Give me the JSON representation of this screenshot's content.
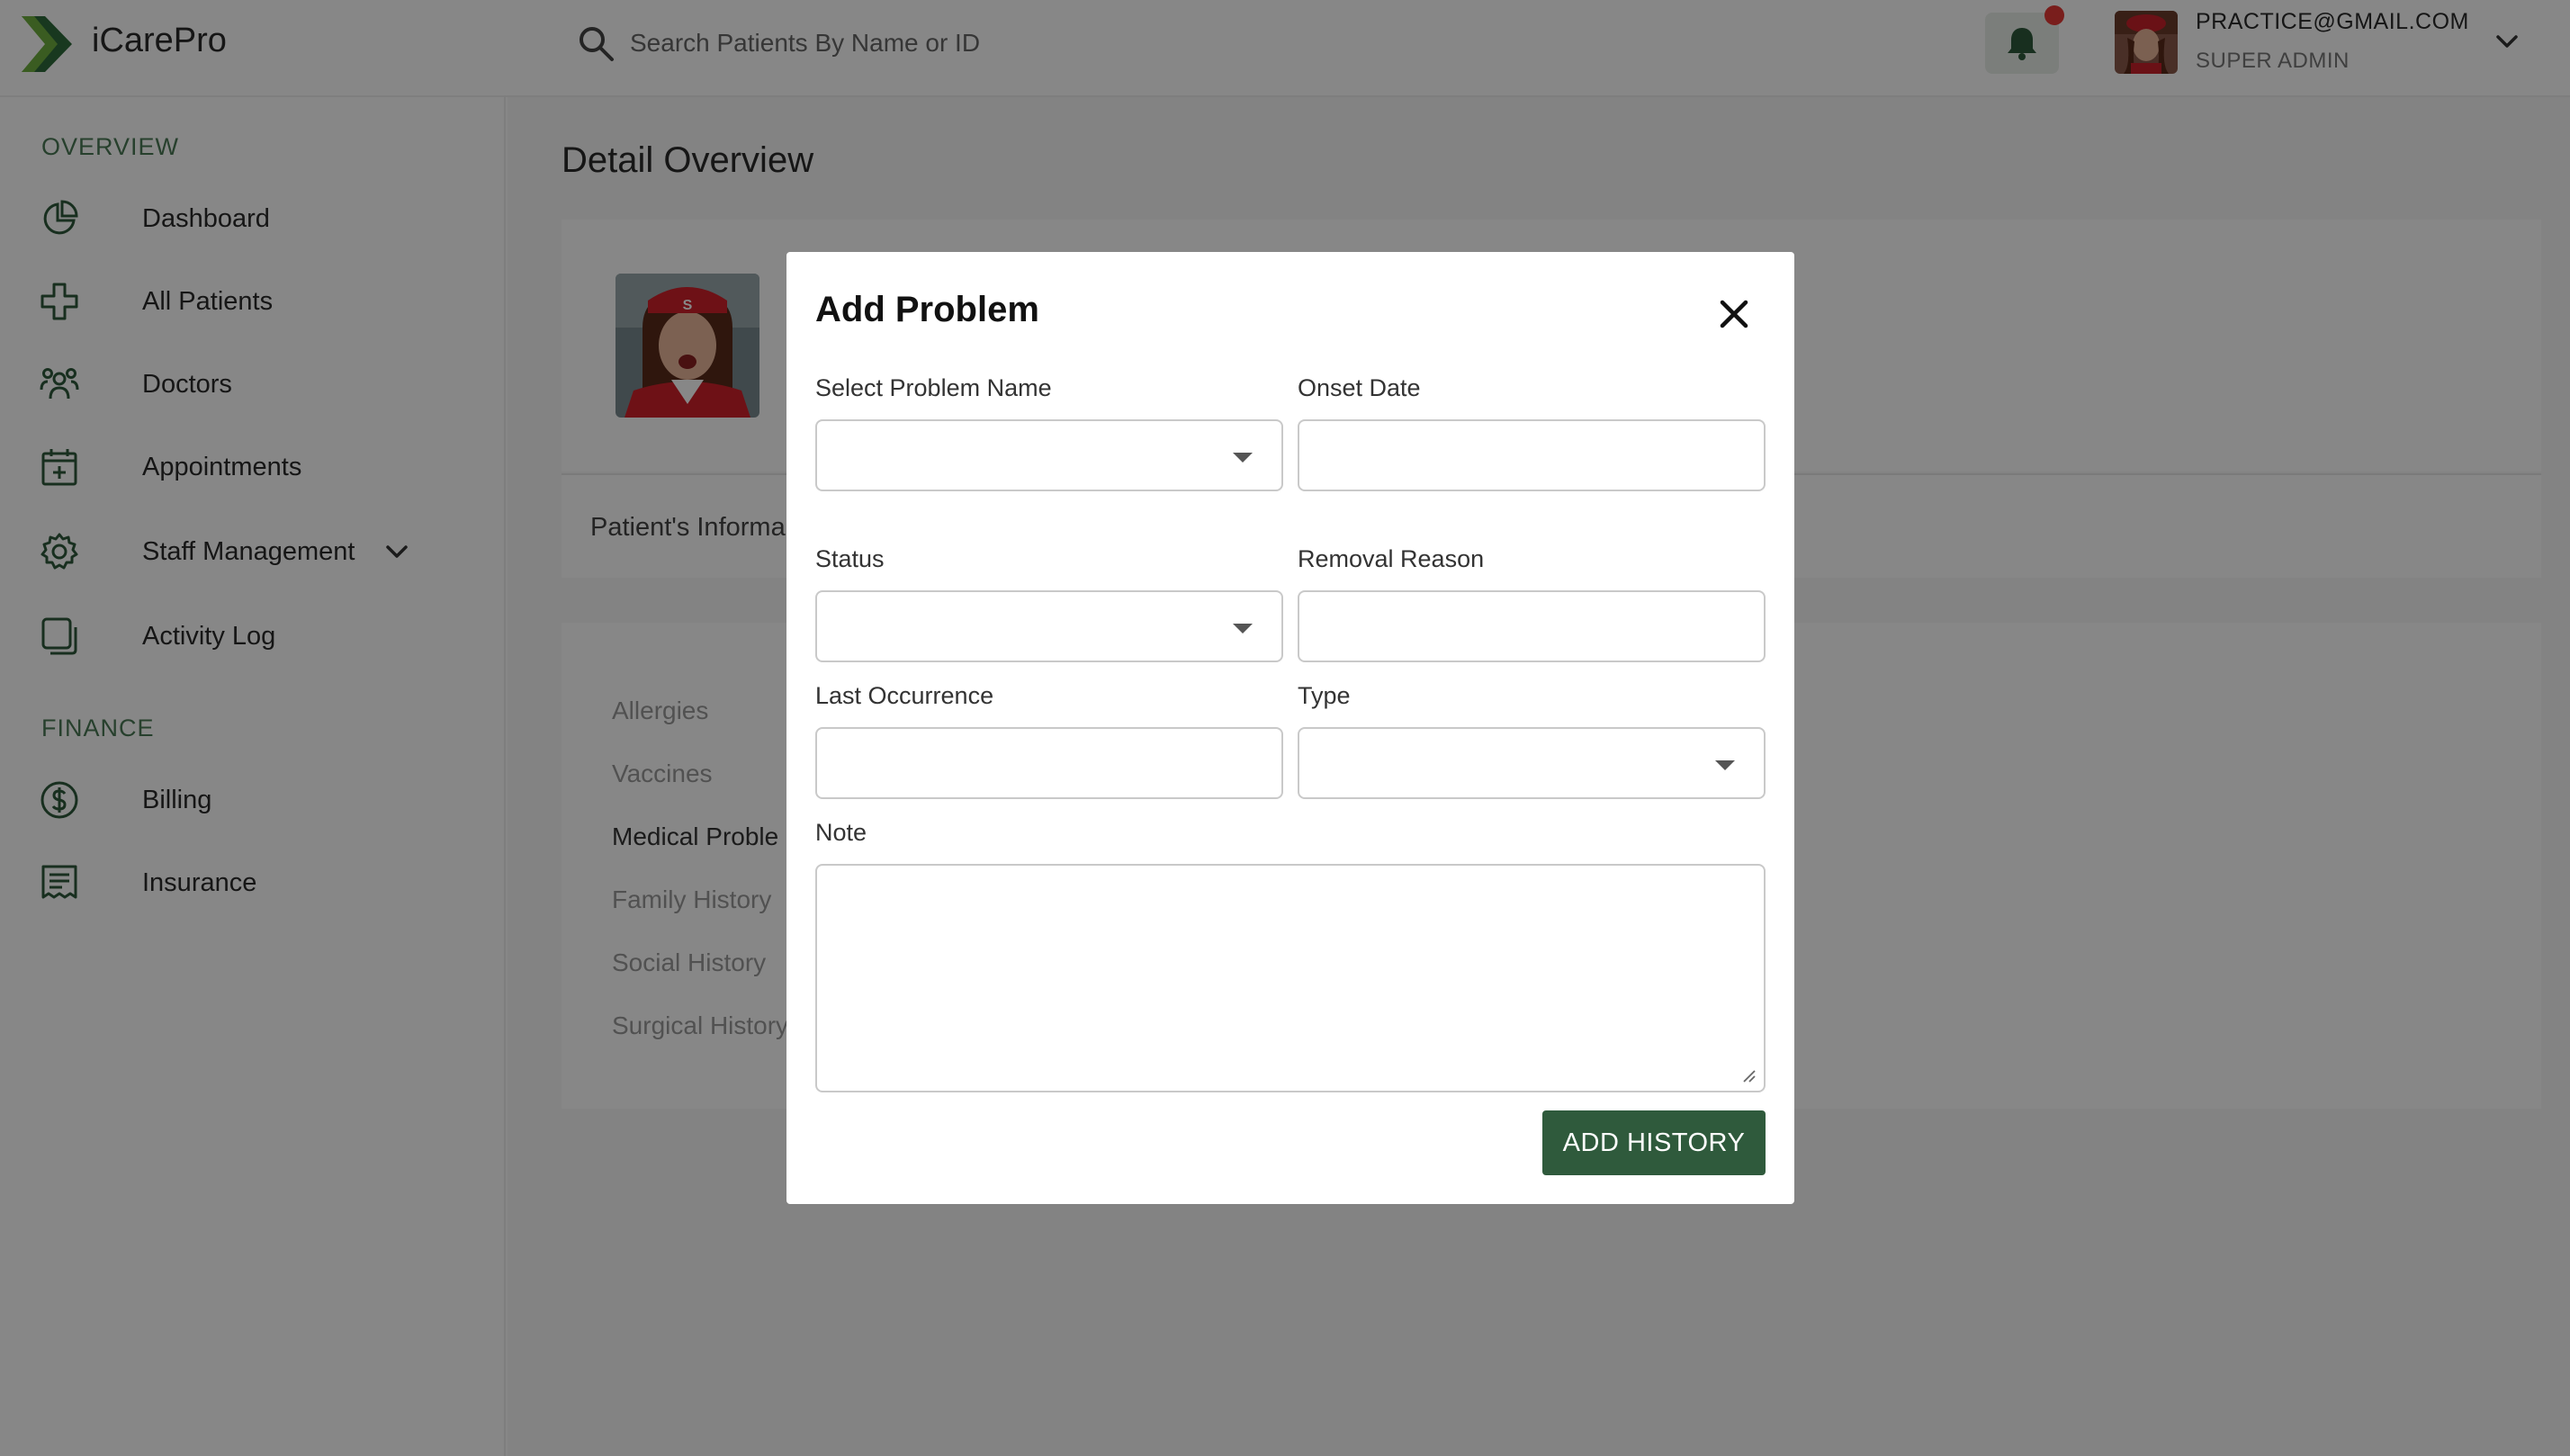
{
  "app": {
    "name": "iCarePro"
  },
  "header": {
    "search_placeholder": "Search Patients By Name or ID",
    "user": {
      "email": "PRACTICE@GMAIL.COM",
      "role": "SUPER ADMIN"
    },
    "notification_indicator": true
  },
  "sidebar": {
    "sections": [
      {
        "title": "OVERVIEW",
        "items": [
          {
            "label": "Dashboard",
            "icon": "pie-chart-icon"
          },
          {
            "label": "All Patients",
            "icon": "medical-cross-icon"
          },
          {
            "label": "Doctors",
            "icon": "users-group-icon"
          },
          {
            "label": "Appointments",
            "icon": "calendar-plus-icon"
          },
          {
            "label": "Staff Management",
            "icon": "gear-icon",
            "expandable": true
          },
          {
            "label": "Activity Log",
            "icon": "copy-icon"
          }
        ]
      },
      {
        "title": "FINANCE",
        "items": [
          {
            "label": "Billing",
            "icon": "dollar-circle-icon"
          },
          {
            "label": "Insurance",
            "icon": "receipt-icon"
          }
        ]
      }
    ]
  },
  "main": {
    "title": "Detail Overview",
    "info_tab": "Patient's Informa",
    "history_items": [
      {
        "label": "Allergies",
        "active": false
      },
      {
        "label": "Vaccines",
        "active": false
      },
      {
        "label": "Medical Proble",
        "active": true
      },
      {
        "label": "Family History",
        "active": false
      },
      {
        "label": "Social History",
        "active": false
      },
      {
        "label": "Surgical History",
        "active": false
      }
    ]
  },
  "modal": {
    "title": "Add Problem",
    "fields": {
      "problem_name": {
        "label": "Select Problem Name",
        "value": ""
      },
      "onset_date": {
        "label": "Onset Date",
        "value": ""
      },
      "status": {
        "label": "Status",
        "value": ""
      },
      "removal_reason": {
        "label": "Removal Reason",
        "value": ""
      },
      "last_occurrence": {
        "label": "Last Occurrence",
        "value": ""
      },
      "type": {
        "label": "Type",
        "value": ""
      },
      "note": {
        "label": "Note",
        "value": ""
      }
    },
    "submit_label": "ADD HISTORY"
  },
  "colors": {
    "brand": "#2f5a3c",
    "accent_green": "#4a7a55",
    "notification": "#e53935",
    "overlay": "rgba(0,0,0,0.47)"
  }
}
